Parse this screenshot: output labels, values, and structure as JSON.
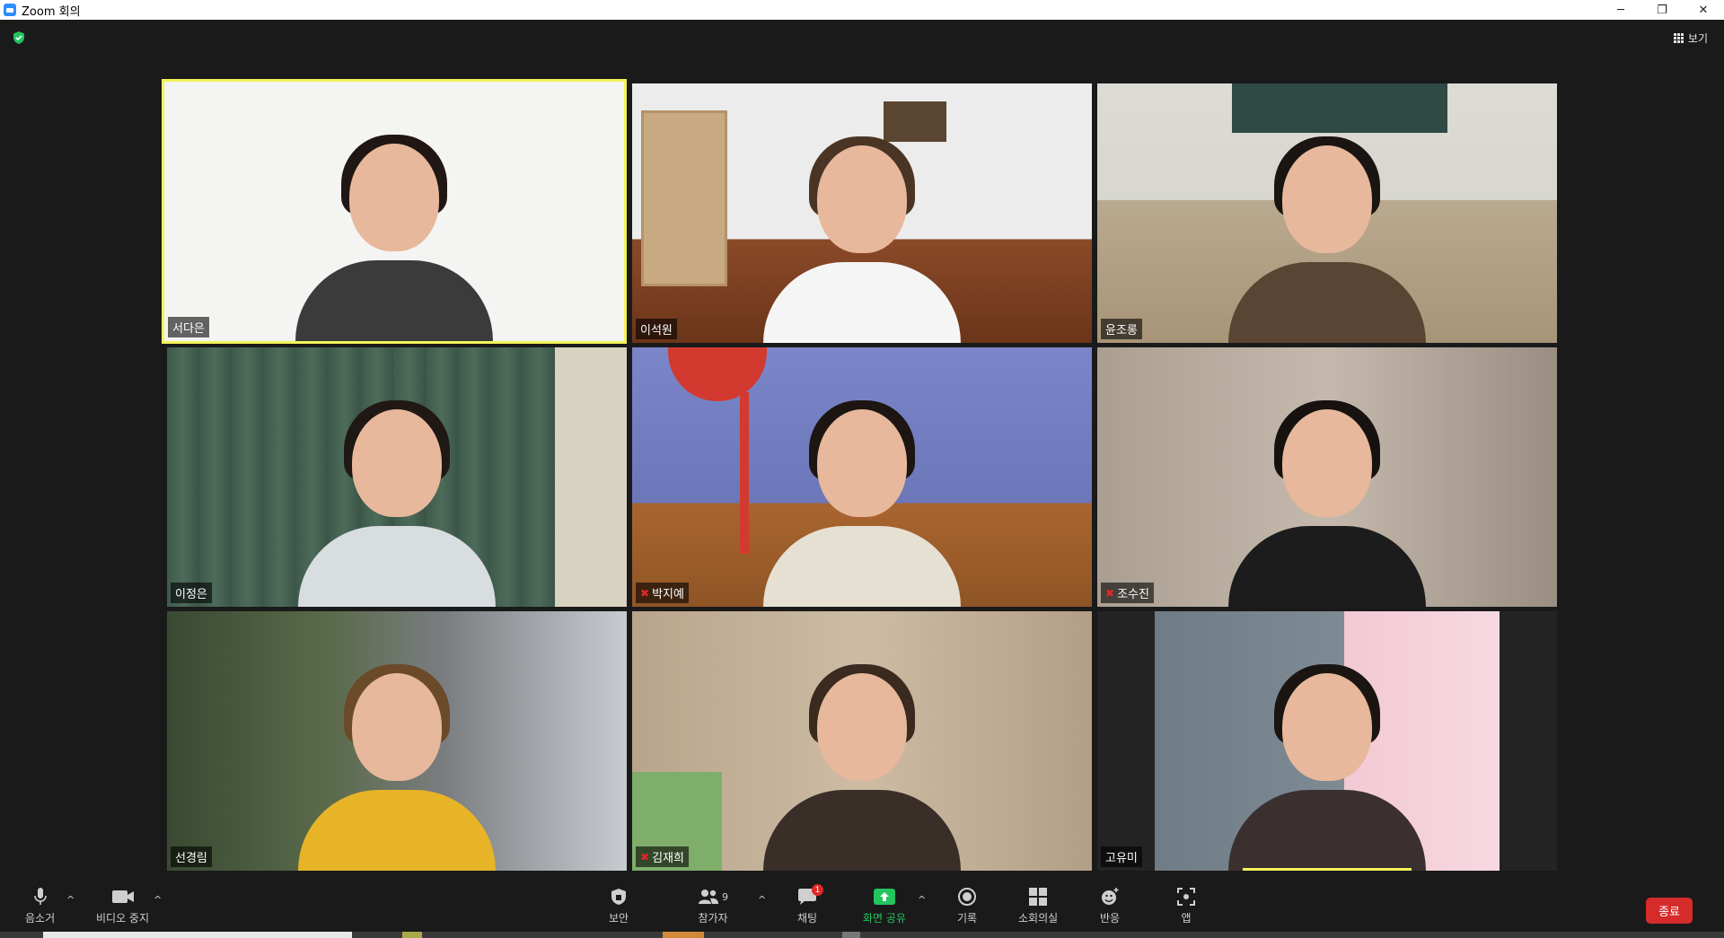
{
  "window": {
    "title": "Zoom 회의",
    "controls": {
      "minimize": "─",
      "restore": "❐",
      "close": "✕"
    }
  },
  "top": {
    "view_label": "보기"
  },
  "participants_grid": [
    {
      "name": "서다은",
      "muted": false,
      "active_speaker": true
    },
    {
      "name": "이석원",
      "muted": false,
      "active_speaker": false
    },
    {
      "name": "윤조롱",
      "muted": false,
      "active_speaker": false
    },
    {
      "name": "이정은",
      "muted": false,
      "active_speaker": false
    },
    {
      "name": "박지예",
      "muted": true,
      "active_speaker": false
    },
    {
      "name": "조수진",
      "muted": true,
      "active_speaker": false
    },
    {
      "name": "선경림",
      "muted": false,
      "active_speaker": false
    },
    {
      "name": "김재희",
      "muted": true,
      "active_speaker": false
    },
    {
      "name": "고유미",
      "muted": false,
      "active_speaker": false
    }
  ],
  "toolbar": {
    "mute_label": "음소거",
    "video_label": "비디오 중지",
    "security_label": "보안",
    "participants_label": "참가자",
    "participants_count": "9",
    "chat_label": "채팅",
    "chat_badge": "1",
    "share_label": "화면 공유",
    "record_label": "기록",
    "breakout_label": "소회의실",
    "reactions_label": "반응",
    "apps_label": "앱",
    "end_label": "종료"
  },
  "colors": {
    "active_speaker_border": "#f3f35a",
    "share_green": "#22c55e",
    "end_red": "#d62b2b",
    "mute_red": "#e02828",
    "background": "#1a1a1a"
  }
}
